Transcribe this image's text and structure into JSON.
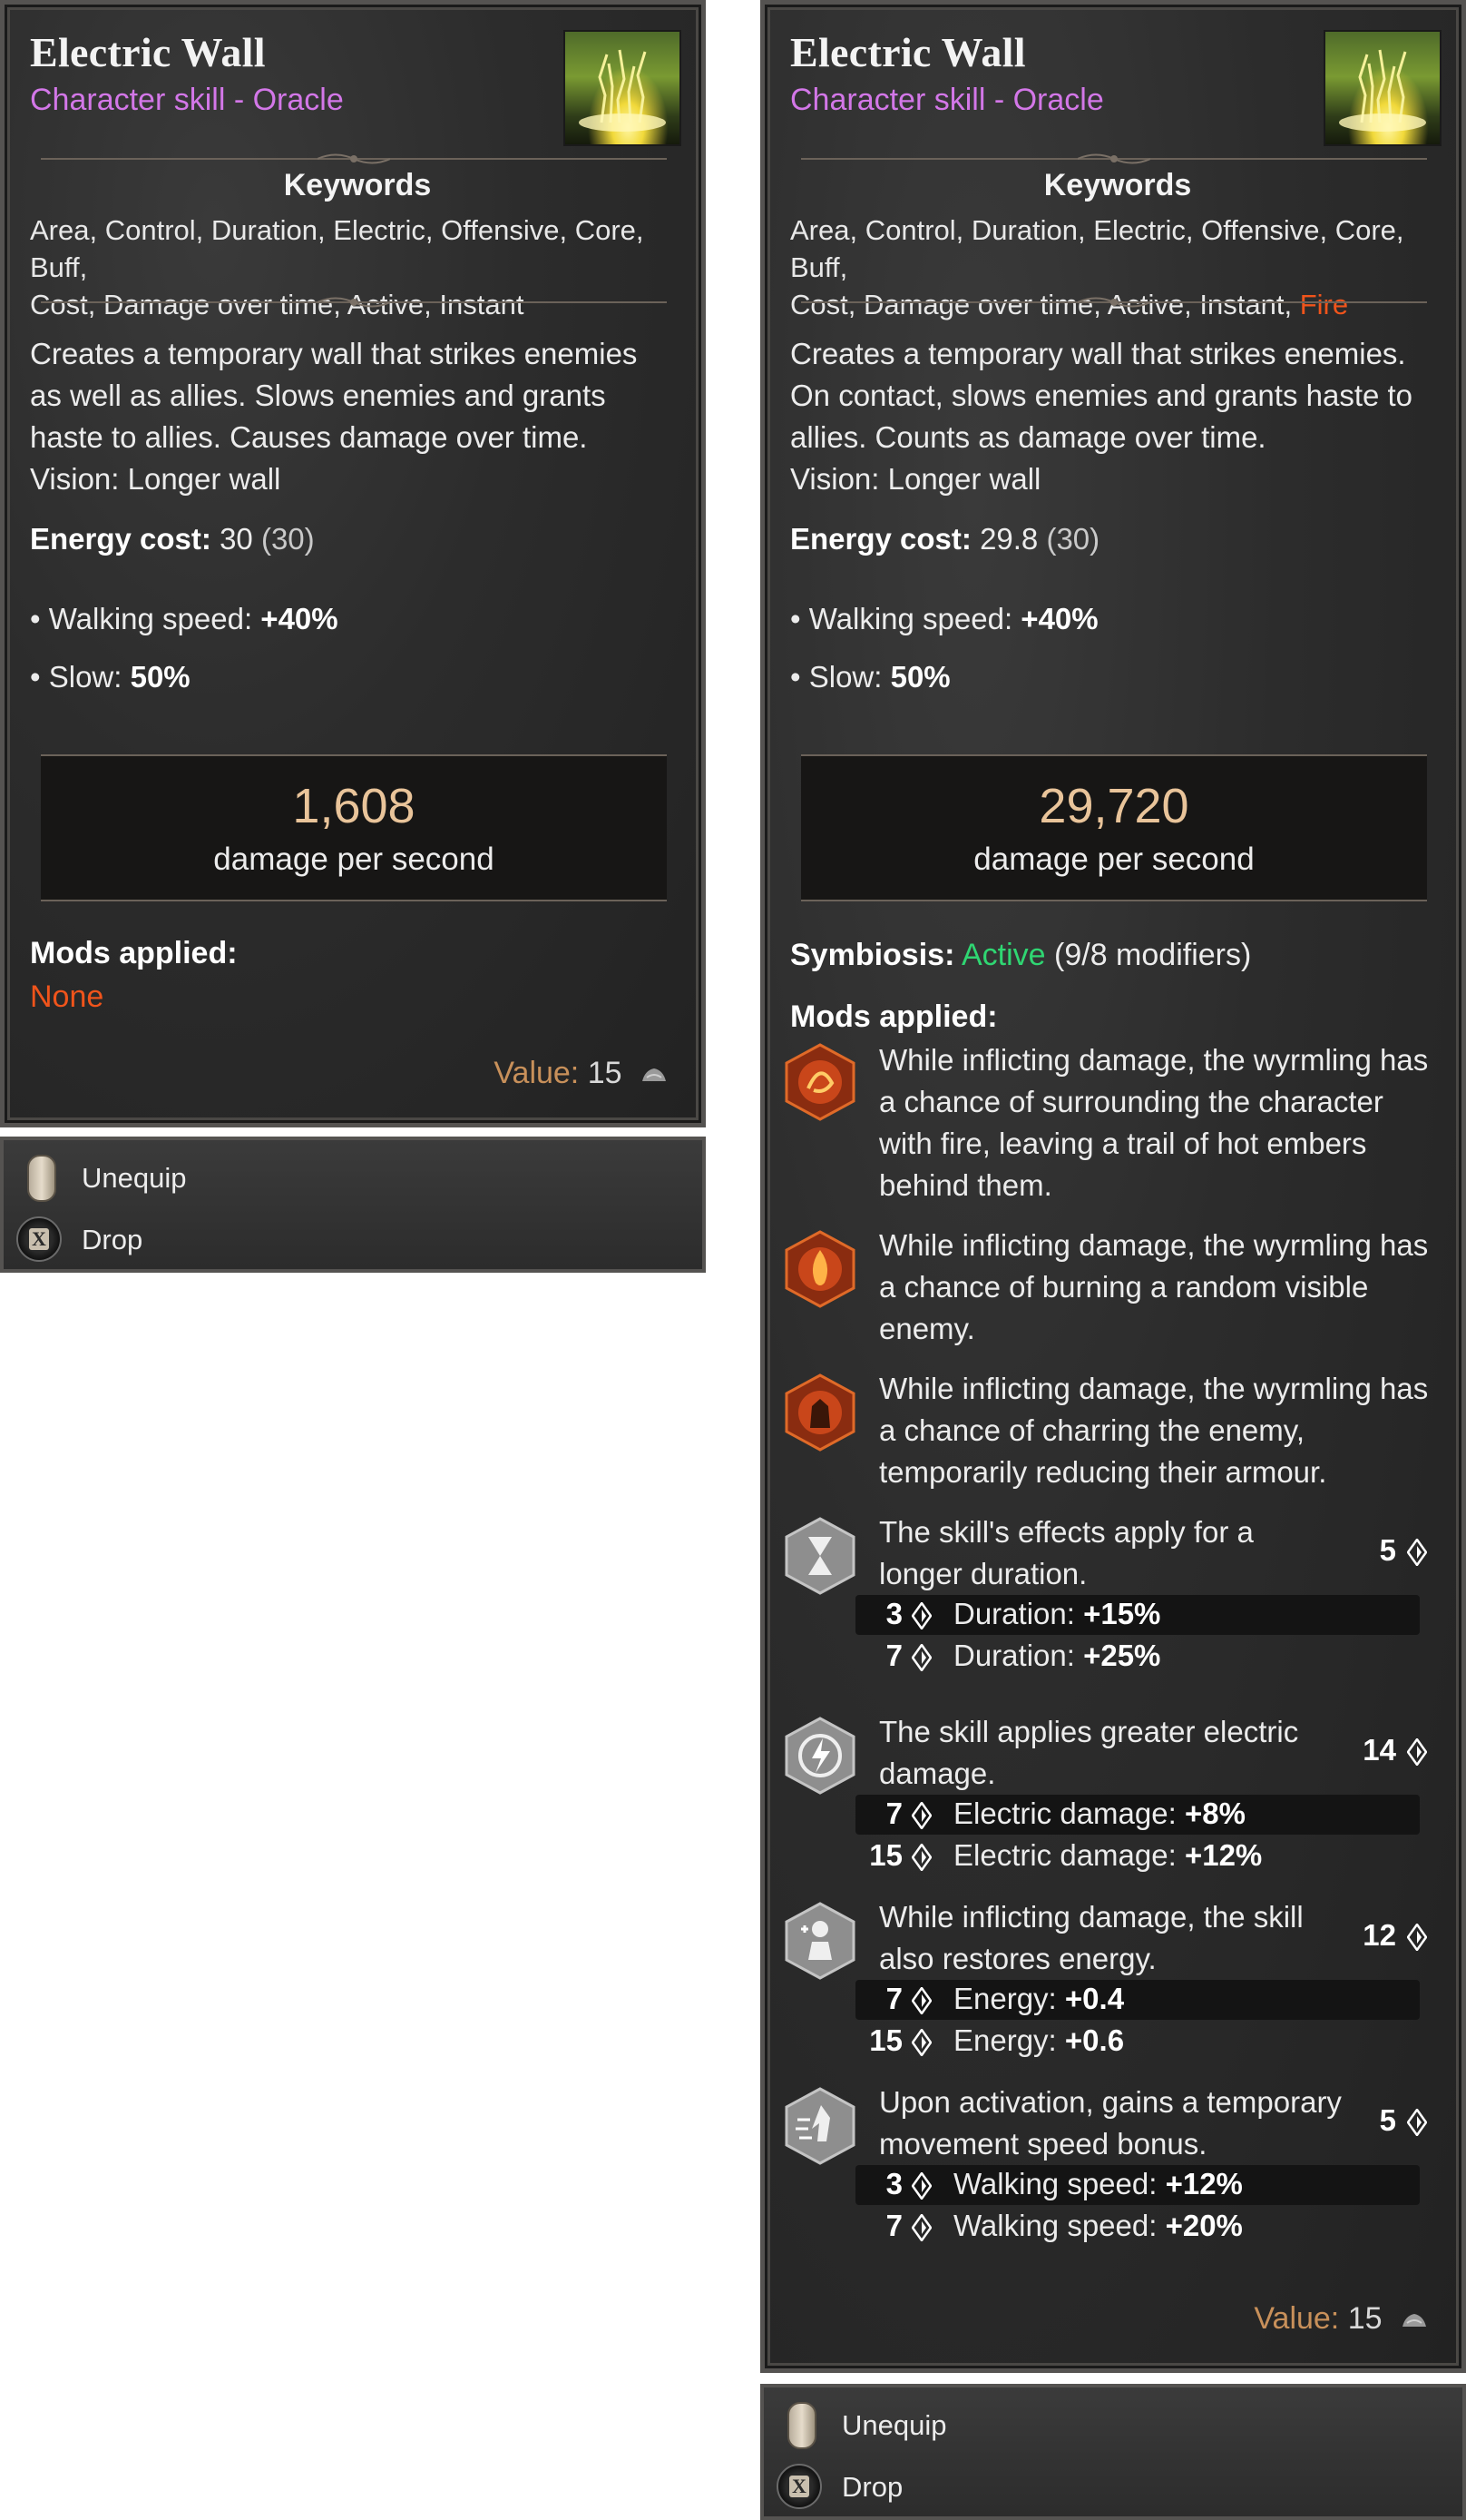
{
  "left": {
    "title": "Electric Wall",
    "subtitle": "Character skill - Oracle",
    "keywords_heading": "Keywords",
    "keywords_line1": "Area, Control, Duration, Electric, Offensive, Core, Buff,",
    "keywords_line2": "Cost, Damage over time, Active, Instant",
    "description": [
      "Creates a temporary wall that strikes enemies",
      "as well as allies. Slows enemies and grants",
      "haste to allies. Causes damage over time.",
      "Vision: Longer wall"
    ],
    "energy_label": "Energy cost:",
    "energy_value": "30",
    "energy_base": "(30)",
    "walking_label": "• Walking speed:",
    "walking_value": "+40%",
    "slow_label": "• Slow:",
    "slow_value": "50%",
    "dps_value": "1,608",
    "dps_label": "damage per second",
    "mods_heading": "Mods applied:",
    "mods_none": "None",
    "value_label": "Value:",
    "value_amount": "15",
    "unequip_label": "Unequip",
    "drop_label": "Drop",
    "key_x": "X"
  },
  "right": {
    "title": "Electric Wall",
    "subtitle": "Character skill - Oracle",
    "keywords_heading": "Keywords",
    "keywords_line1": "Area, Control, Duration, Electric, Offensive, Core, Buff,",
    "keywords_line2": "Cost, Damage over time, Active, Instant,",
    "keywords_fire": "Fire",
    "description": [
      "Creates a temporary wall that strikes enemies.",
      "On contact, slows enemies and grants haste to",
      "allies. Counts as damage over time.",
      "Vision: Longer wall"
    ],
    "energy_label": "Energy cost:",
    "energy_value": "29.8",
    "energy_base": "(30)",
    "walking_label": "• Walking speed:",
    "walking_value": "+40%",
    "slow_label": "• Slow:",
    "slow_value": "50%",
    "dps_value": "29,720",
    "dps_label": "damage per second",
    "symbiosis_label": "Symbiosis:",
    "symbiosis_status": "Active",
    "symbiosis_count": "(9/8 modifiers)",
    "mods_heading": "Mods applied:",
    "wyrm_mods": [
      {
        "icon": "fire-trail-icon",
        "lines": [
          "While inflicting damage, the wyrmling has",
          "a chance of surrounding the character",
          "with fire, leaving a trail of hot embers",
          "behind them."
        ]
      },
      {
        "icon": "burning-enemy-icon",
        "lines": [
          "While inflicting damage, the wyrmling has",
          "a chance of burning a random visible",
          "enemy."
        ]
      },
      {
        "icon": "char-armour-icon",
        "lines": [
          "While inflicting damage, the wyrmling has",
          "a chance of charring the enemy,",
          "temporarily reducing their armour."
        ]
      }
    ],
    "tier_mods": [
      {
        "icon": "hourglass-icon",
        "lines": [
          "The skill's effects apply for a",
          "longer duration."
        ],
        "points": "5",
        "tiers": [
          {
            "num": "3",
            "label": "Duration:",
            "value": "+15%"
          },
          {
            "num": "7",
            "label": "Duration:",
            "value": "+25%"
          }
        ]
      },
      {
        "icon": "electric-damage-icon",
        "lines": [
          "The skill applies greater electric",
          "damage."
        ],
        "points": "14",
        "tiers": [
          {
            "num": "7",
            "label": "Electric damage:",
            "value": "+8%"
          },
          {
            "num": "15",
            "label": "Electric damage:",
            "value": "+12%"
          }
        ]
      },
      {
        "icon": "energy-restore-icon",
        "lines": [
          "While inflicting damage, the skill",
          "also restores energy."
        ],
        "points": "12",
        "tiers": [
          {
            "num": "7",
            "label": "Energy:",
            "value": "+0.4"
          },
          {
            "num": "15",
            "label": "Energy:",
            "value": "+0.6"
          }
        ]
      },
      {
        "icon": "movement-speed-icon",
        "lines": [
          "Upon activation, gains a temporary",
          "movement speed bonus."
        ],
        "points": "5",
        "tiers": [
          {
            "num": "3",
            "label": "Walking speed:",
            "value": "+12%"
          },
          {
            "num": "7",
            "label": "Walking speed:",
            "value": "+20%"
          }
        ]
      }
    ],
    "value_label": "Value:",
    "value_amount": "15",
    "unequip_label": "Unequip",
    "drop_label": "Drop",
    "key_x": "X"
  },
  "colors": {
    "subtitle_purple": "#d377e8",
    "fire_orange": "#f0541b",
    "active_green": "#2fd672",
    "dps_gold": "#e9c49a",
    "value_bronze": "#c8905a"
  }
}
